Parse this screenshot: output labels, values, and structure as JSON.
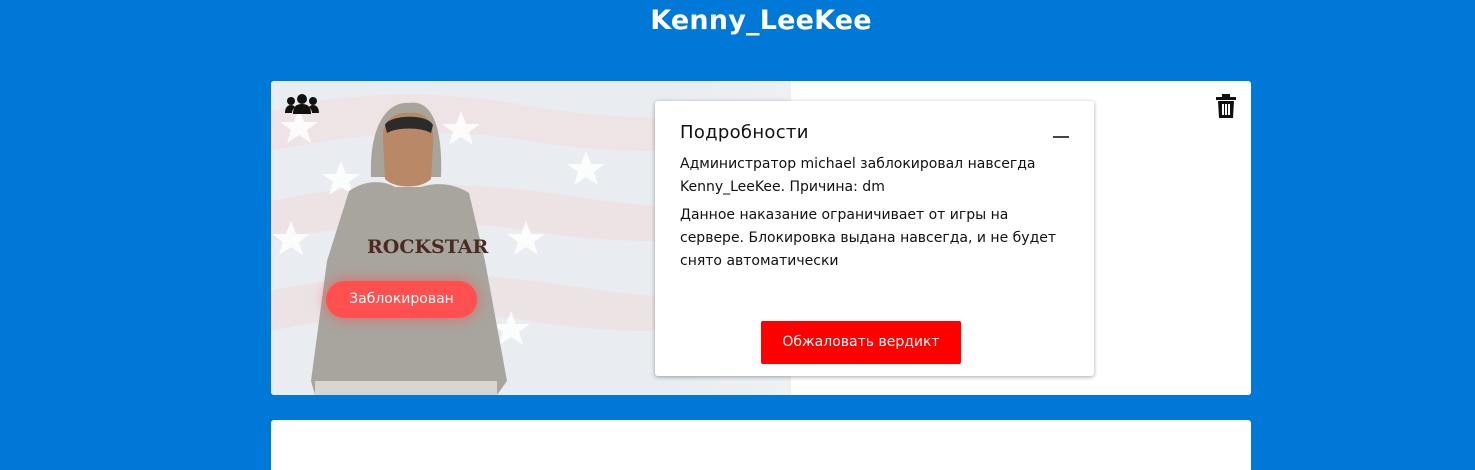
{
  "header": {
    "title": "Kenny_LeeKee"
  },
  "card": {
    "status_badge": "Заблокирован",
    "details": {
      "title": "Подробности",
      "description": "Администратор michael заблокировал навсегда Kenny_LeeKee. Причина: dm",
      "note": "Данное наказание ограничивает от игры на сервере. Блокировка выдана навсегда, и не будет снято автоматически",
      "appeal_button": "Обжаловать вердикт"
    },
    "character_hoodie_text": "ROCKSTAR",
    "icons": {
      "left": "users-icon",
      "right": "trash-icon"
    }
  },
  "colors": {
    "page_background": "#0078d7",
    "status_badge": "#ff4f4f",
    "appeal_button": "#ff0000",
    "card_background": "#ffffff"
  }
}
